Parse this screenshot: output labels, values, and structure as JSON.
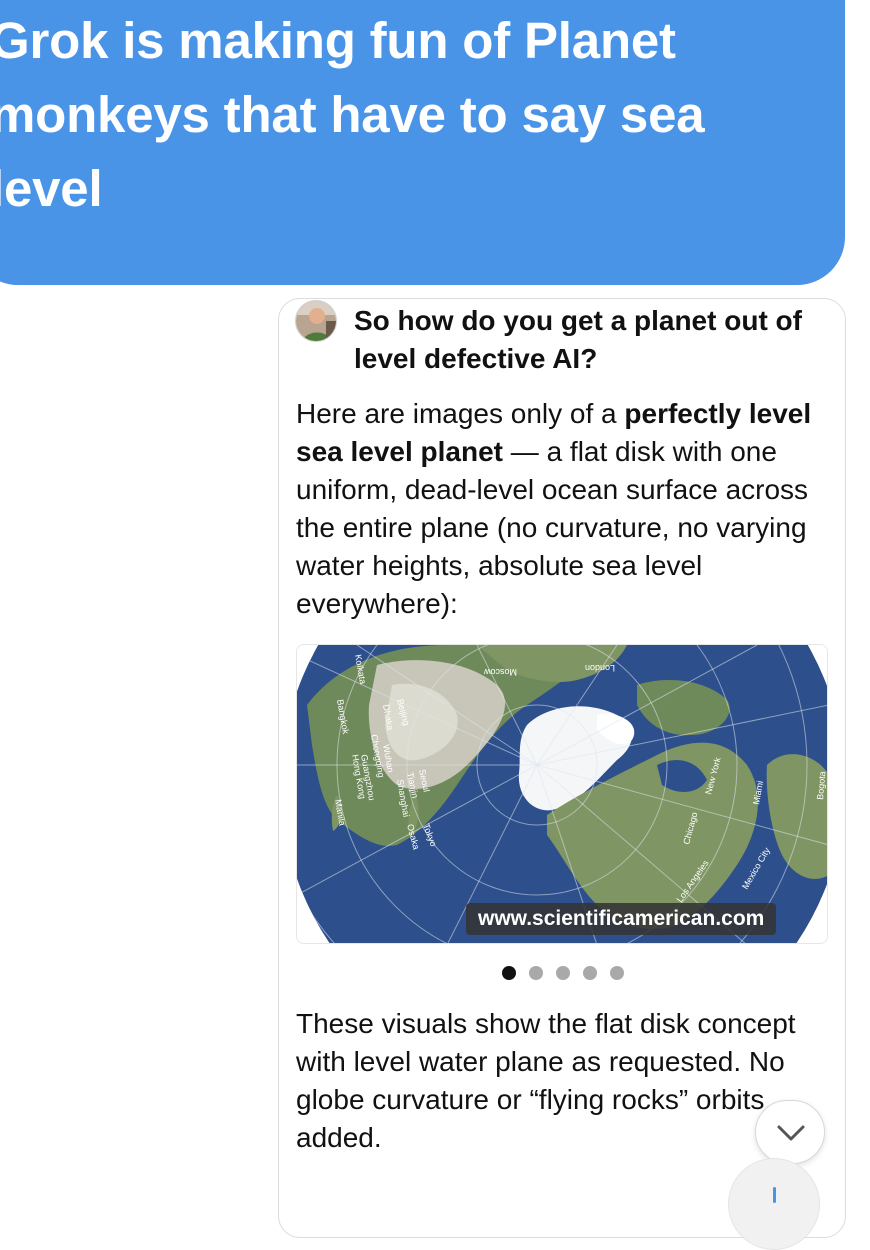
{
  "post": {
    "text": "Grok is making fun of Planet monkeys that have to say sea level",
    "bubble_color": "#4a94e8"
  },
  "quoted": {
    "question": "So how do you get a planet out of level defective AI?",
    "answer_intro_1": "Here are images only of a ",
    "answer_intro_bold": "perfectly level sea level planet",
    "answer_intro_2": " — a flat disk with one uniform, dead-level ocean surface across the entire plane (no curvature, no varying water heights, absolute sea level everywhere):",
    "image": {
      "source": "www.scientificamerican.com",
      "place_labels": [
        "Moscow",
        "London",
        "Beijing",
        "Chongqing",
        "Wuhan",
        "Guangzhou",
        "Hong Kong",
        "Manila",
        "Shanghai",
        "Tianjin",
        "Seoul",
        "Osaka",
        "Tokyo",
        "Chicago",
        "New York",
        "Miami",
        "Bogota",
        "Mexico City",
        "Los Angeles",
        "Dhaka",
        "Kolkata",
        "Bangkok"
      ]
    },
    "carousel": {
      "count": 5,
      "active_index": 0
    },
    "answer_outro": "These visuals show the flat disk concept with level water plane as requested. No globe curvature or “flying rocks” orbits added.",
    "scroll_button_icon": "chevron-down-icon",
    "compose_icon": "compose-icon"
  }
}
